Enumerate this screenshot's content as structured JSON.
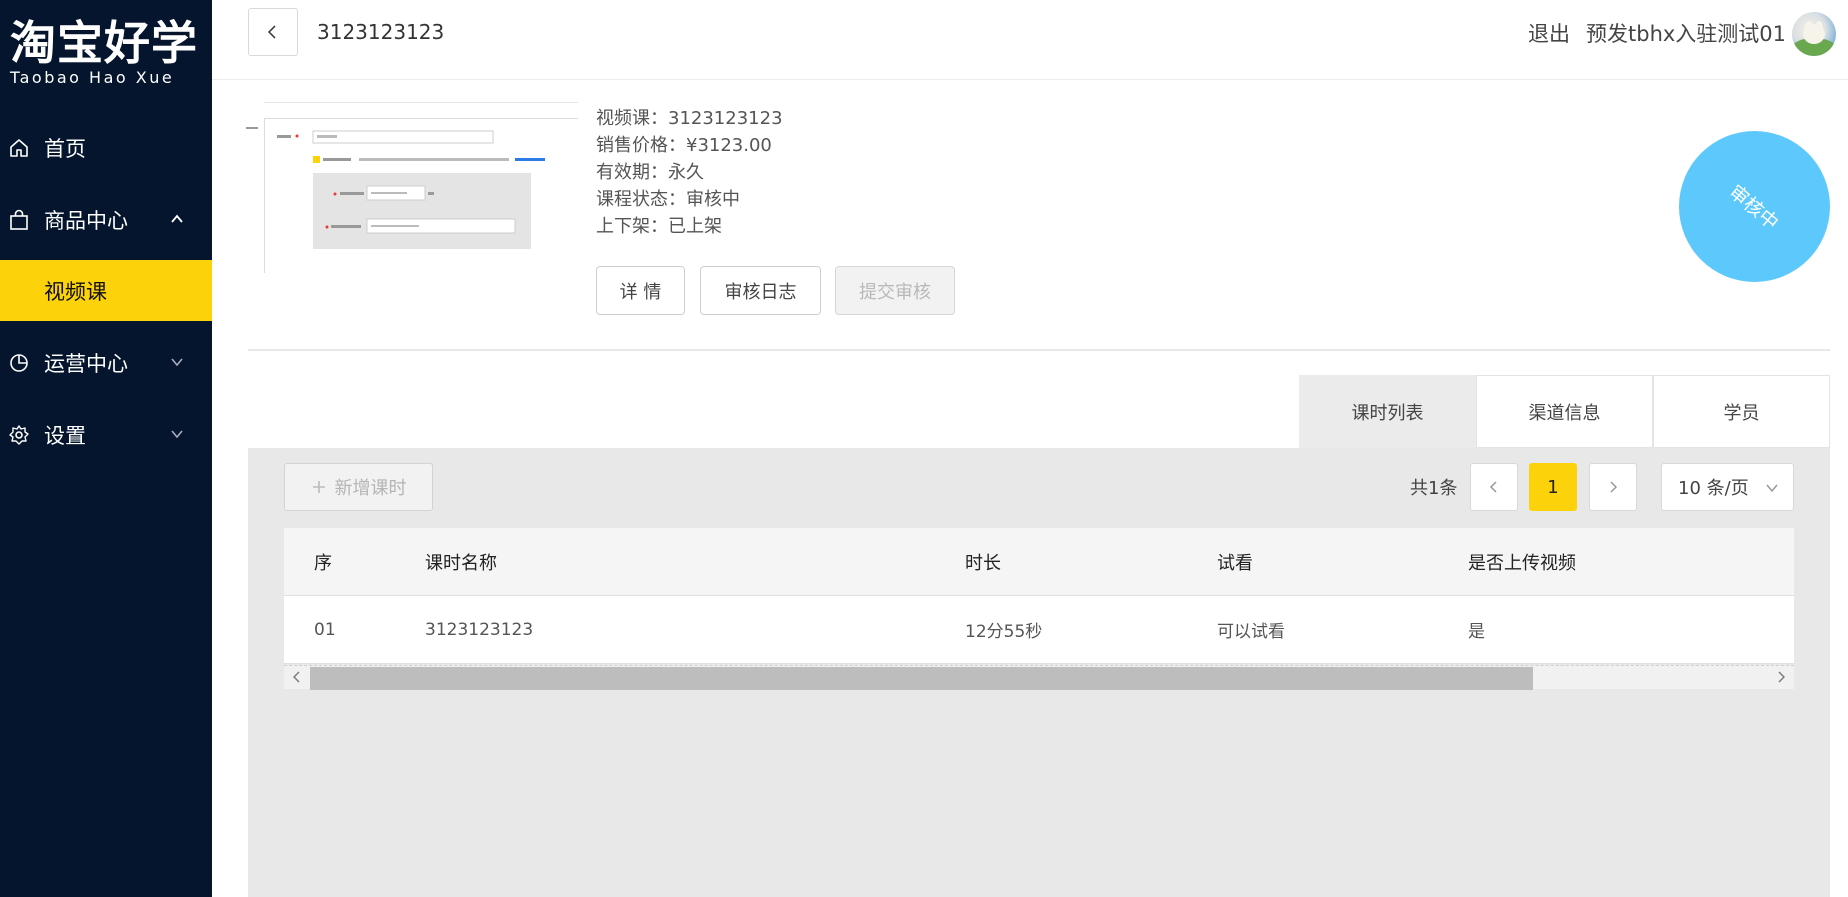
{
  "brand": {
    "name_cn": "淘宝好学",
    "name_en": "Taobao Hao Xue"
  },
  "sidebar": {
    "items": [
      {
        "label": "首页",
        "icon": "home-icon"
      },
      {
        "label": "商品中心",
        "icon": "bag-icon",
        "expanded": true
      },
      {
        "label": "视频课",
        "active": true
      },
      {
        "label": "运营中心",
        "icon": "pie-chart-icon",
        "expanded": false
      },
      {
        "label": "设置",
        "icon": "gear-icon",
        "expanded": false
      }
    ]
  },
  "header": {
    "title": "3123123123",
    "logout": "退出",
    "user": "预发tbhx入驻测试01"
  },
  "product": {
    "lines": [
      "视频课：3123123123",
      "销售价格：¥3123.00",
      "有效期：永久",
      "课程状态：审核中",
      "上下架：已上架"
    ],
    "buttons": {
      "detail": "详 情",
      "audit_log": "审核日志",
      "submit_audit": "提交审核"
    },
    "status_stamp": "审核中",
    "status_color": "#5dc8fb"
  },
  "tabs": [
    {
      "label": "课时列表",
      "active": true
    },
    {
      "label": "渠道信息"
    },
    {
      "label": "学员"
    }
  ],
  "lessons": {
    "add_label": "新增课时",
    "total": "共1条",
    "page": "1",
    "page_size": "10 条/页",
    "columns": [
      "序",
      "课时名称",
      "时长",
      "试看",
      "是否上传视频"
    ],
    "rows": [
      [
        "01",
        "3123123123",
        "12分55秒",
        "可以试看",
        "是"
      ]
    ]
  },
  "colors": {
    "sidebar_bg": "#04152d",
    "accent": "#fcd20b"
  }
}
